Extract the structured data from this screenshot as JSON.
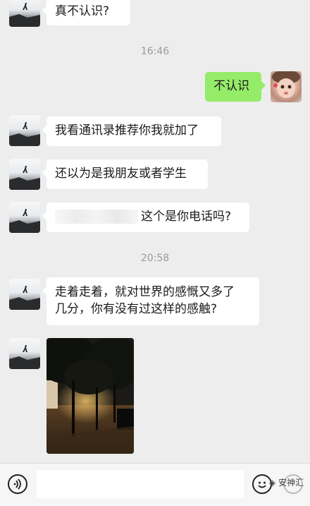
{
  "messages": [
    {
      "text": "真不认识?"
    },
    {
      "text": "不认识"
    },
    {
      "text": "我看通讯录推荐你我就加了"
    },
    {
      "text": "还以为是我朋友或者学生"
    },
    {
      "text": "这个是你电话吗?"
    },
    {
      "line1": "走着走着，就对世界的感慨又多了",
      "line2": "几分，你有没有过这样的感触?"
    }
  ],
  "timestamps": [
    "16:46",
    "20:58"
  ],
  "watermark": "安神汇",
  "colors": {
    "background": "#ededed",
    "bubble_mine": "#95ec69",
    "bubble_other": "#ffffff",
    "timestamp": "#9b9b9b"
  },
  "icons": {
    "voice": "voice-icon",
    "emoji": "emoji-icon",
    "more": "plus-icon"
  }
}
